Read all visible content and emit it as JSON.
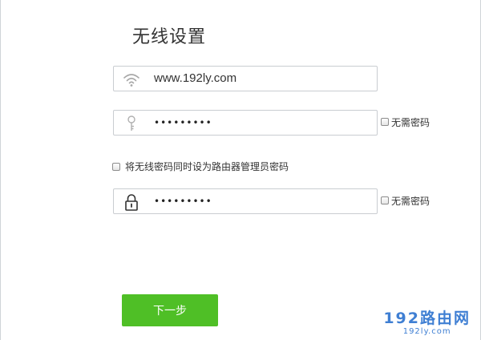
{
  "page": {
    "title": "无线设置"
  },
  "form": {
    "ssid": {
      "icon": "wifi-icon",
      "value": "www.192ly.com"
    },
    "wifi_password": {
      "icon": "key-icon",
      "value": "•••••••••",
      "no_password_label": "无需密码"
    },
    "sync_admin": {
      "label": "将无线密码同时设为路由器管理员密码",
      "checked": false
    },
    "admin_password": {
      "icon": "lock-icon",
      "value": "•••••••••",
      "no_password_label": "无需密码"
    }
  },
  "buttons": {
    "next_label": "下一步"
  },
  "watermark": {
    "main": "192路由网",
    "sub": "192ly.com"
  },
  "colors": {
    "button_green": "#4fbf26",
    "border_gray": "#c9cdd1",
    "watermark_blue": "#3f7fd3"
  }
}
